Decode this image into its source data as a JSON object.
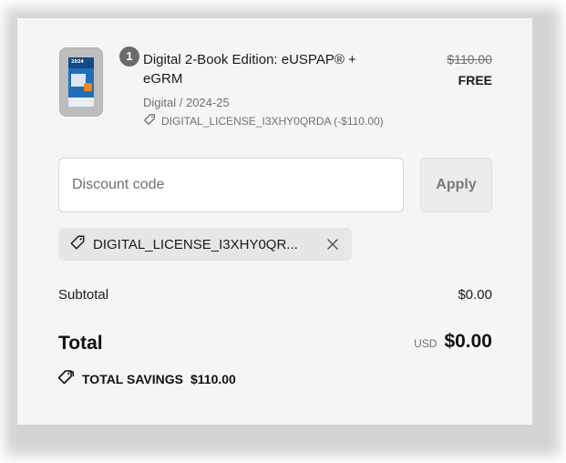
{
  "line_item": {
    "quantity": "1",
    "title": "Digital 2-Book Edition: eUSPAP® + eGRM",
    "variant": "Digital / 2024-25",
    "applied_discount": "DIGITAL_LICENSE_I3XHY0QRDA (-$110.00)",
    "original_price": "$110.00",
    "final_price": "FREE",
    "thumbnail_year": "2024"
  },
  "discount": {
    "placeholder": "Discount code",
    "value": "",
    "apply_label": "Apply",
    "applied_code_chip": "DIGITAL_LICENSE_I3XHY0QR..."
  },
  "totals": {
    "subtotal_label": "Subtotal",
    "subtotal_value": "$0.00",
    "total_label": "Total",
    "currency": "USD",
    "total_value": "$0.00",
    "savings_label": "TOTAL SAVINGS",
    "savings_value": "$110.00"
  },
  "icons": {
    "tag": "tag-icon",
    "remove": "close-icon",
    "savings": "tags-icon"
  },
  "colors": {
    "panel_bg": "#f5f5f5",
    "muted_text": "#707070",
    "badge_bg": "#6b6b6b",
    "chip_bg": "#e6e6e6"
  }
}
